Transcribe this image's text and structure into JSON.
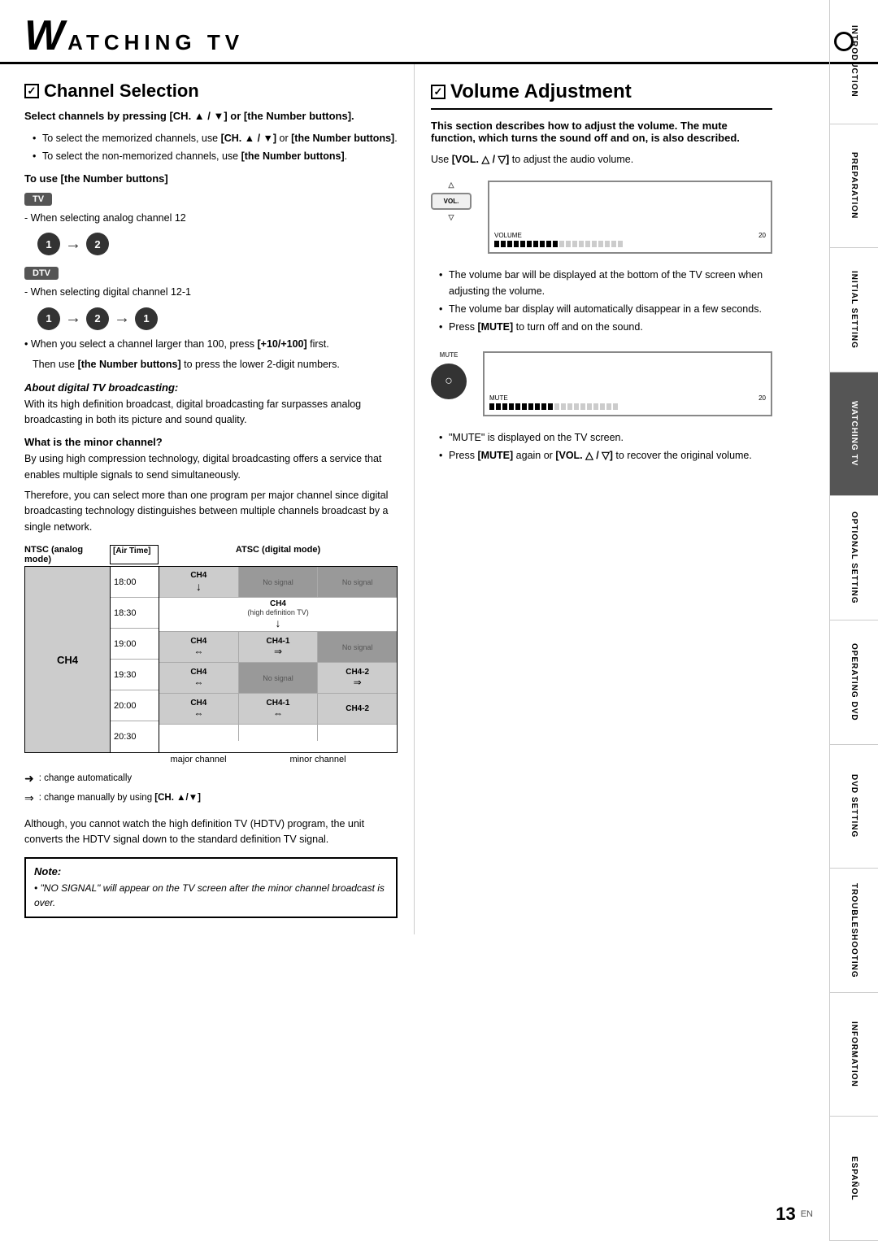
{
  "header": {
    "w_letter": "W",
    "title": "ATCHING  TV",
    "circle": ""
  },
  "sidebar": {
    "tabs": [
      {
        "label": "INTRODUCTION",
        "active": false
      },
      {
        "label": "PREPARATION",
        "active": false
      },
      {
        "label": "INITIAL SETTING",
        "active": false
      },
      {
        "label": "WATCHING TV",
        "active": true
      },
      {
        "label": "OPTIONAL SETTING",
        "active": false
      },
      {
        "label": "OPERATING DVD",
        "active": false
      },
      {
        "label": "DVD SETTING",
        "active": false
      },
      {
        "label": "TROUBLESHOOTING",
        "active": false
      },
      {
        "label": "INFORMATION",
        "active": false
      },
      {
        "label": "ESPAÑOL",
        "active": false
      }
    ]
  },
  "channel_section": {
    "title": "Channel Selection",
    "subtitle": "Select channels by pressing [CH. ▲ / ▼] or [the Number buttons].",
    "bullets": [
      "To select the memorized channels, use [CH. ▲ / ▼] or [the Number buttons].",
      "To select the non-memorized channels, use [the Number buttons]."
    ],
    "number_buttons_heading": "To use [the Number buttons]",
    "tv_badge": "TV",
    "analog_label": "- When selecting analog channel 12",
    "dtv_badge": "DTV",
    "digital_label": "- When selecting digital channel 12-1",
    "analog_buttons": [
      "1",
      "2"
    ],
    "digital_buttons": [
      "1",
      "2",
      "1"
    ],
    "larger_channel_text1": "• When you select a channel larger than 100, press [+10/+100] first.",
    "larger_channel_text2": "Then use [the Number buttons] to press the lower 2-digit numbers.",
    "about_digital_heading": "About digital TV broadcasting:",
    "about_digital_text": "With its high definition broadcast, digital broadcasting far surpasses analog broadcasting in both its picture and sound quality.",
    "minor_channel_heading": "What is the minor channel?",
    "minor_channel_text1": "By using high compression technology, digital broadcasting offers a service that enables multiple signals to send simultaneously.",
    "minor_channel_text2": "Therefore, you can select more than one program per major channel since digital broadcasting technology distinguishes between multiple channels broadcast by a single network.",
    "diagram": {
      "ntsc_label": "NTSC (analog mode)",
      "airtime_label": "[Air Time]",
      "atsc_label": "ATSC (digital mode)",
      "ntsc_channel": "CH4",
      "times": [
        "18:00",
        "18:30",
        "19:00",
        "19:30",
        "20:00",
        "20:30"
      ],
      "rows": [
        {
          "cells": [
            {
              "label": "CH4",
              "sub": "",
              "bg": "gray"
            },
            {
              "label": "No signal",
              "bg": "dark"
            },
            {
              "label": "No signal",
              "bg": "dark"
            }
          ]
        },
        {
          "cells": [
            {
              "label": "CH4",
              "sub": "(high definition TV)",
              "bg": "white"
            }
          ]
        },
        {
          "cells": [
            {
              "label": "CH4",
              "bg": "gray"
            },
            {
              "label": "CH4-1",
              "bg": "gray"
            },
            {
              "label": "No signal",
              "bg": "dark"
            }
          ]
        },
        {
          "cells": [
            {
              "label": "CH4",
              "bg": "gray"
            },
            {
              "label": "No signal",
              "bg": "dark"
            },
            {
              "label": "CH4-2",
              "bg": "gray"
            }
          ]
        },
        {
          "cells": [
            {
              "label": "CH4",
              "bg": "gray"
            },
            {
              "label": "CH4-1",
              "bg": "gray"
            },
            {
              "label": "CH4-2",
              "bg": "gray"
            }
          ]
        },
        {
          "cells": []
        }
      ],
      "major_channel_label": "major channel",
      "minor_channel_label": "minor channel"
    },
    "legend1": "➜ : change automatically",
    "legend2": "⇒ : change manually by using [CH. ▲/▼]",
    "hdtv_text": "Although, you cannot watch the high definition TV (HDTV) program, the unit converts the HDTV signal down to the standard definition TV signal.",
    "note_title": "Note:",
    "note_text": "• \"NO SIGNAL\" will appear on the TV screen after the minor channel broadcast is over."
  },
  "volume_section": {
    "title": "Volume Adjustment",
    "subtitle": "This section describes how to adjust the volume. The mute function, which turns the sound off and on, is also described.",
    "use_vol_text": "Use [VOL. △ / ▽] to adjust the audio volume.",
    "vol_label": "VOL.",
    "vol_number": "20",
    "volume_label": "VOLUME",
    "bullets": [
      "The volume bar will be displayed at the bottom of the TV screen when adjusting the volume.",
      "The volume bar display will automatically disappear in a few seconds.",
      "Press [MUTE] to turn off and on the sound."
    ],
    "mute_label": "MUTE",
    "mute_number": "20",
    "mute_screen_label": "MUTE",
    "mute_bullets": [
      "\"MUTE\" is displayed on the TV screen.",
      "Press [MUTE] again or [VOL. △ / ▽] to recover the original volume."
    ]
  },
  "page": {
    "number": "13",
    "en_label": "EN"
  }
}
